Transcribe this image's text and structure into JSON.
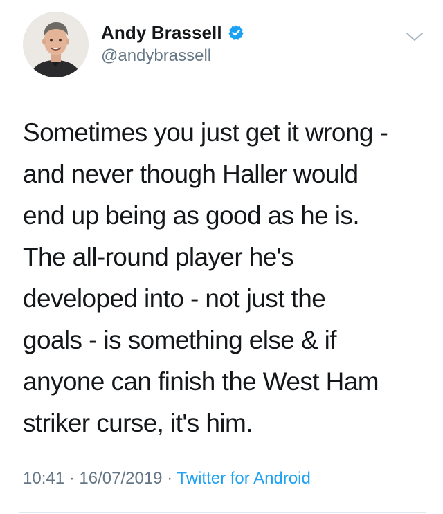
{
  "tweet": {
    "author": {
      "display_name": "Andy Brassell",
      "handle": "@andybrassell",
      "verified": true,
      "avatar_icon": "profile-photo"
    },
    "text": "Sometimes you just get it wrong -\nand never though Haller would\nend up being as good as he is.\nThe all-round player he's\ndeveloped into - not just the\ngoals - is something else & if\nanyone can finish the West Ham\nstriker curse, it's him.",
    "time": "10:41",
    "separator": " · ",
    "date": "16/07/2019",
    "source": "Twitter for Android"
  },
  "colors": {
    "primary_text": "#14171a",
    "secondary_text": "#657786",
    "accent": "#1da1f2",
    "divider": "#e1e8ed"
  },
  "icons": {
    "verified": "verified-badge-icon",
    "menu": "chevron-down-icon"
  }
}
